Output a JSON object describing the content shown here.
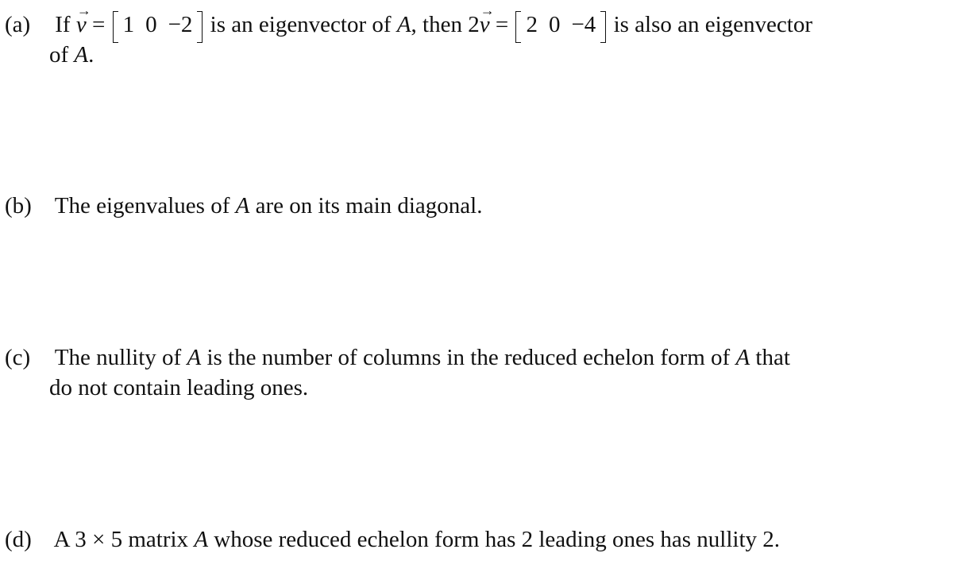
{
  "items": [
    {
      "label": "(a)",
      "part1": "If",
      "vec_symbol": "v",
      "eq": "=",
      "vector1": [
        "1",
        "0",
        "−2"
      ],
      "part2": "is an eigenvector of",
      "matrix_var": "A",
      "part3": ", then 2",
      "vector2": [
        "2",
        "0",
        "−4"
      ],
      "part4": "is also an eigenvector",
      "line2_pre": "of",
      "line2_post": "."
    },
    {
      "label": "(b)",
      "pre": "The eigenvalues of",
      "matrix_var": "A",
      "post": "are on its main diagonal."
    },
    {
      "label": "(c)",
      "pre": "The nullity of",
      "matrix_var": "A",
      "mid": "is the number of columns in the reduced echelon form of",
      "post": "that",
      "line2": "do not contain leading ones."
    },
    {
      "label": "(d)",
      "pre": "A 3 × 5 matrix",
      "matrix_var": "A",
      "post": "whose reduced echelon form has 2 leading ones has nullity 2."
    }
  ]
}
